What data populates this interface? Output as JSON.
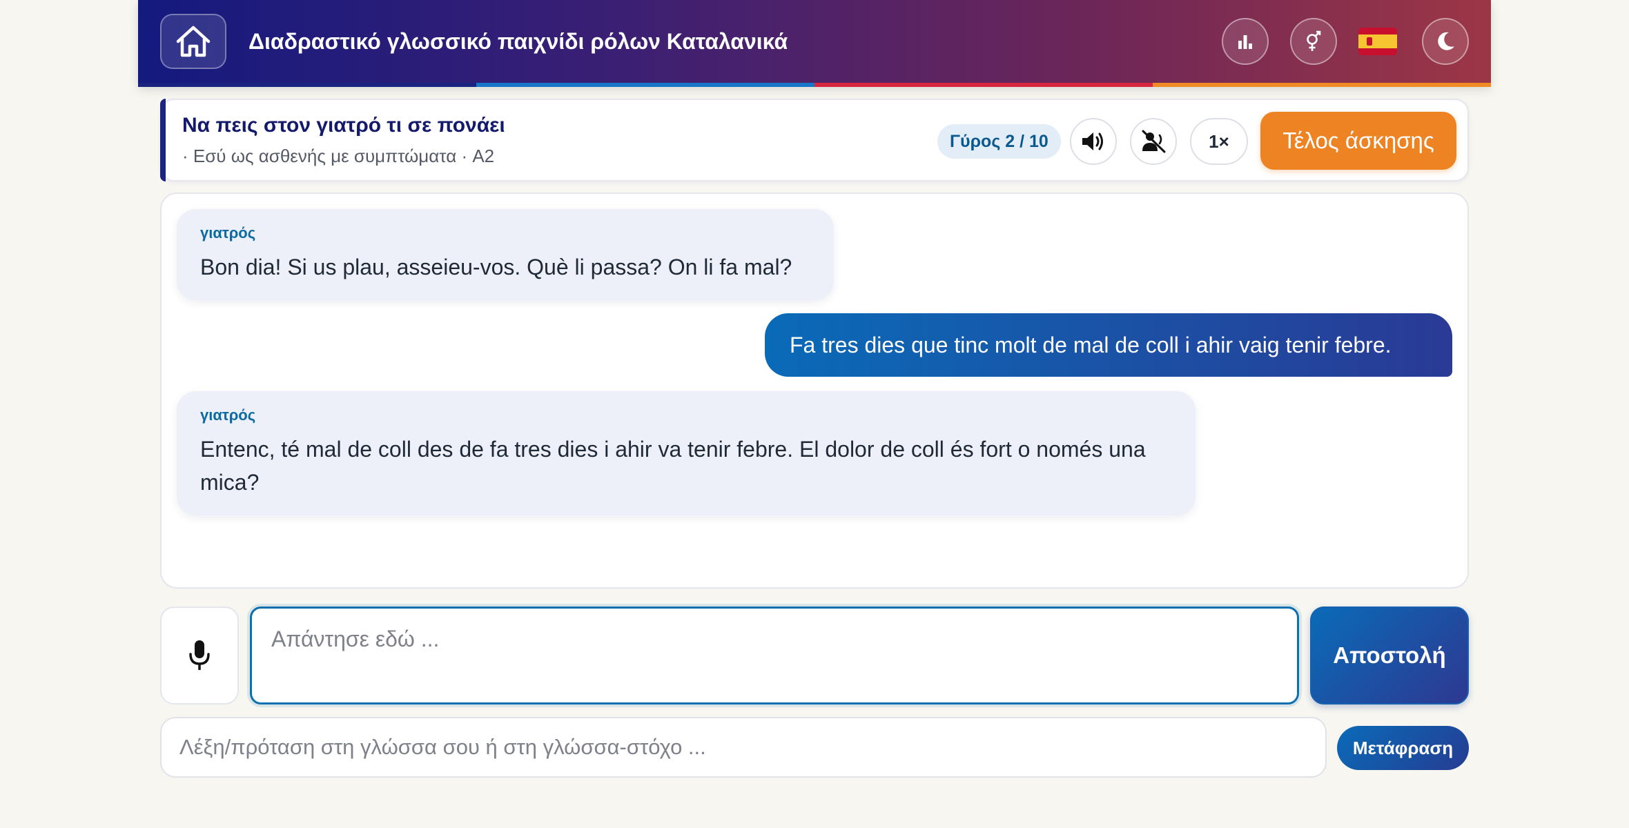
{
  "header": {
    "title": "Διαδραστικό γλωσσικό παιχνίδι ρόλων Καταλανικά",
    "home_icon": "home-icon",
    "stats_icon": "bar-chart-icon",
    "gender_icon": "gender-icon",
    "flag": "🇪🇸",
    "theme_icon": "moon-icon",
    "stripe_colors": [
      "#1a2480",
      "#1877c9",
      "#d9263f",
      "#f08a24"
    ]
  },
  "scenario": {
    "title": "Να πεις στον γιατρό τι σε πονάει",
    "subtitle": "· Εσύ ως ασθενής με συμπτώματα · A2",
    "round_label": "Γύρος 2 / 10",
    "speaker_icon": "speaker-icon",
    "mute_icon": "voice-off-icon",
    "speed_label": "1×",
    "end_label": "Τέλος άσκησης"
  },
  "chat": {
    "messages": [
      {
        "role": "bot",
        "speaker": "γιατρός",
        "text": "Bon dia! Si us plau, asseieu-vos. Què li passa? On li fa mal?"
      },
      {
        "role": "user",
        "text": "Fa tres dies que tinc molt de mal de coll i ahir vaig tenir febre."
      },
      {
        "role": "bot",
        "speaker": "γιατρός",
        "text": "Entenc, té mal de coll des de fa tres dies i ahir va tenir febre. El dolor de coll és fort o només una mica?"
      }
    ]
  },
  "input": {
    "mic_icon": "microphone-icon",
    "reply_placeholder": "Απάντησε εδώ ...",
    "reply_value": "",
    "send_label": "Αποστολή"
  },
  "translate": {
    "placeholder": "Λέξη/πρόταση στη γλώσσα σου ή στη γλώσσα-στόχο ...",
    "value": "",
    "button_label": "Μετάφραση"
  },
  "colors": {
    "accent_blue": "#0b6fb0",
    "accent_orange": "#ee8323",
    "navy": "#141a7e"
  }
}
